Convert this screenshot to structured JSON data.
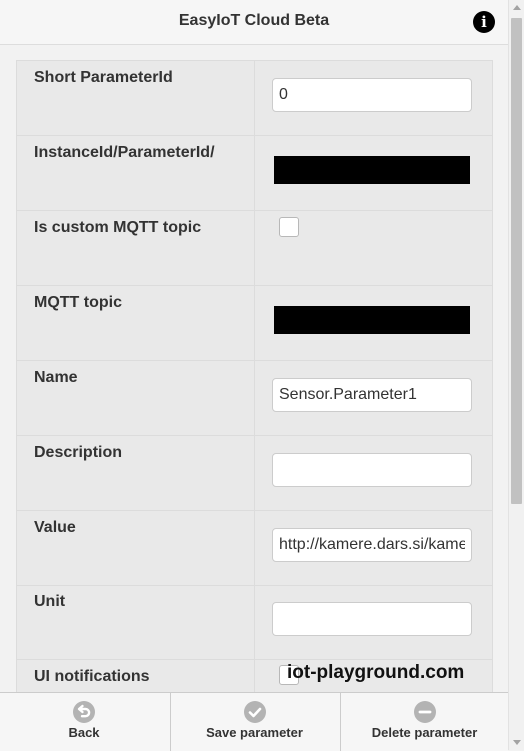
{
  "header": {
    "title": "EasyIoT Cloud Beta",
    "info_icon": "info-icon"
  },
  "form": {
    "fields": [
      {
        "label": "Short ParameterId",
        "type": "text",
        "value": "0"
      },
      {
        "label": "InstanceId/ParameterId/",
        "type": "redacted"
      },
      {
        "label": "Is custom MQTT topic",
        "type": "checkbox",
        "checked": false
      },
      {
        "label": "MQTT topic",
        "type": "redacted"
      },
      {
        "label": "Name",
        "type": "text",
        "value": "Sensor.Parameter1"
      },
      {
        "label": "Description",
        "type": "text",
        "value": ""
      },
      {
        "label": "Value",
        "type": "text",
        "value": "http://kamere.dars.si/kamere/"
      },
      {
        "label": "Unit",
        "type": "text",
        "value": ""
      },
      {
        "label": "UI notifications",
        "type": "checkbox",
        "checked": false
      }
    ]
  },
  "watermark": "iot-playground.com",
  "footer": {
    "back_label": "Back",
    "save_label": "Save parameter",
    "delete_label": "Delete parameter"
  },
  "colors": {
    "header_bg": "#f6f6f6",
    "row_bg": "#e9e9e9",
    "icon_grey": "#b3b3b3"
  }
}
